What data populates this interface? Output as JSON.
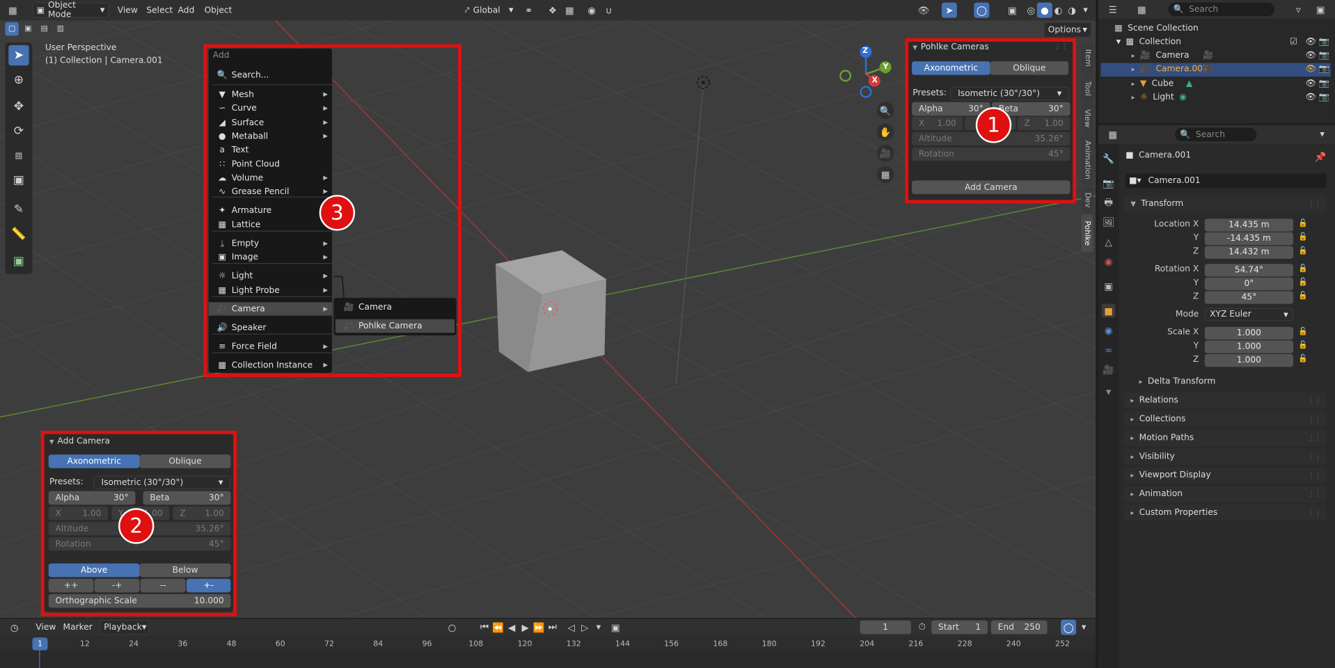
{
  "colors": {
    "accent": "#4772b3",
    "highlight_box": "#e01010",
    "viewport_bg": "#3d3d3d",
    "panel_bg": "#2a2a2a"
  },
  "header": {
    "editor_icon": "editor-type-icon",
    "mode": "Object Mode",
    "menus": [
      "View",
      "Select",
      "Add",
      "Object"
    ],
    "orientation": "Global",
    "options": "Options"
  },
  "viewport": {
    "perspective": "User Perspective",
    "collection_info": "(1) Collection | Camera.001"
  },
  "add_menu": {
    "title": "Add",
    "search": "Search...",
    "items": [
      {
        "label": "Mesh",
        "icon": "mesh-icon",
        "sub": true
      },
      {
        "label": "Curve",
        "icon": "curve-icon",
        "sub": true
      },
      {
        "label": "Surface",
        "icon": "surface-icon",
        "sub": true
      },
      {
        "label": "Metaball",
        "icon": "metaball-icon",
        "sub": true
      },
      {
        "label": "Text",
        "icon": "text-icon",
        "sub": false
      },
      {
        "label": "Point Cloud",
        "icon": "point-cloud-icon",
        "sub": false
      },
      {
        "label": "Volume",
        "icon": "volume-icon",
        "sub": true
      },
      {
        "label": "Grease Pencil",
        "icon": "grease-pencil-icon",
        "sub": true
      },
      {
        "label": "Armature",
        "icon": "armature-icon",
        "sub": false
      },
      {
        "label": "Lattice",
        "icon": "lattice-icon",
        "sub": false
      },
      {
        "label": "Empty",
        "icon": "empty-icon",
        "sub": true
      },
      {
        "label": "Image",
        "icon": "image-icon",
        "sub": true
      },
      {
        "label": "Light",
        "icon": "light-icon",
        "sub": true
      },
      {
        "label": "Light Probe",
        "icon": "light-probe-icon",
        "sub": true
      },
      {
        "label": "Camera",
        "icon": "camera-icon",
        "sub": true
      },
      {
        "label": "Speaker",
        "icon": "speaker-icon",
        "sub": false
      },
      {
        "label": "Force Field",
        "icon": "force-field-icon",
        "sub": true
      },
      {
        "label": "Collection Instance",
        "icon": "collection-instance-icon",
        "sub": true
      }
    ],
    "camera_submenu": [
      "Camera",
      "Pohlke Camera"
    ]
  },
  "pohlke_panel": {
    "title": "Pohlke Cameras",
    "tab_axonometric": "Axonometric",
    "tab_oblique": "Oblique",
    "presets_label": "Presets:",
    "preset_value": "Isometric (30°/30°)",
    "alpha_label": "Alpha",
    "alpha_value": "30°",
    "beta_label": "Beta",
    "beta_value": "30°",
    "x_label": "X",
    "x_value": "1.00",
    "z_label": "Z",
    "z_value": "1.00",
    "altitude_label": "Altitude",
    "altitude_value": "35.26°",
    "rotation_label": "Rotation",
    "rotation_value": "45°",
    "add_button": "Add Camera"
  },
  "add_camera_panel": {
    "title": "Add Camera",
    "tab_axonometric": "Axonometric",
    "tab_oblique": "Oblique",
    "presets_label": "Presets:",
    "preset_value": "Isometric (30°/30°)",
    "alpha_label": "Alpha",
    "alpha_value": "30°",
    "beta_label": "Beta",
    "beta_value": "30°",
    "x_label": "X",
    "x_value": "1.00",
    "y_label": "Y",
    "y_value": "1.00",
    "z_label": "Z",
    "z_value": "1.00",
    "altitude_label": "Altitude",
    "altitude_value": "35.26°",
    "rotation_label": "Rotation",
    "rotation_value": "45°",
    "above": "Above",
    "below": "Below",
    "signs": [
      "++",
      "-+",
      "--",
      "+-"
    ],
    "ortho_label": "Orthographic Scale",
    "ortho_value": "10.000"
  },
  "badges": [
    "1",
    "2",
    "3"
  ],
  "side_tabs": [
    "Item",
    "Tool",
    "View",
    "Animation",
    "Dev",
    "Pohlke"
  ],
  "gizmo": {
    "x": "X",
    "y": "Y",
    "z": "Z"
  },
  "outliner": {
    "search": "Search",
    "scene": "Scene Collection",
    "collection": "Collection",
    "items": [
      "Camera",
      "Camera.001",
      "Cube",
      "Light"
    ]
  },
  "properties": {
    "search": "Search",
    "object_name": "Camera.001",
    "datablock": "Camera.001",
    "transform_title": "Transform",
    "location_x_label": "Location X",
    "location_x": "14.435 m",
    "location_y": "-14.435 m",
    "location_z": "14.432 m",
    "rotation_x_label": "Rotation X",
    "rotation_x": "54.74°",
    "rotation_y": "0°",
    "rotation_z": "45°",
    "mode_label": "Mode",
    "mode_value": "XYZ Euler",
    "scale_x_label": "Scale X",
    "scale_x": "1.000",
    "scale_y": "1.000",
    "scale_z": "1.000",
    "y_label": "Y",
    "z_label": "Z",
    "delta": "Delta Transform",
    "sections": [
      "Relations",
      "Collections",
      "Motion Paths",
      "Visibility",
      "Viewport Display",
      "Animation",
      "Custom Properties"
    ]
  },
  "timeline": {
    "menus": [
      "View",
      "Marker",
      "Playback"
    ],
    "current_frame": "1",
    "start_label": "Start",
    "start": "1",
    "end_label": "End",
    "end": "250",
    "ticks": [
      "1",
      "12",
      "24",
      "36",
      "48",
      "60",
      "72",
      "84",
      "96",
      "108",
      "120",
      "132",
      "144",
      "156",
      "168",
      "180",
      "192",
      "204",
      "216",
      "228",
      "240",
      "252"
    ]
  }
}
